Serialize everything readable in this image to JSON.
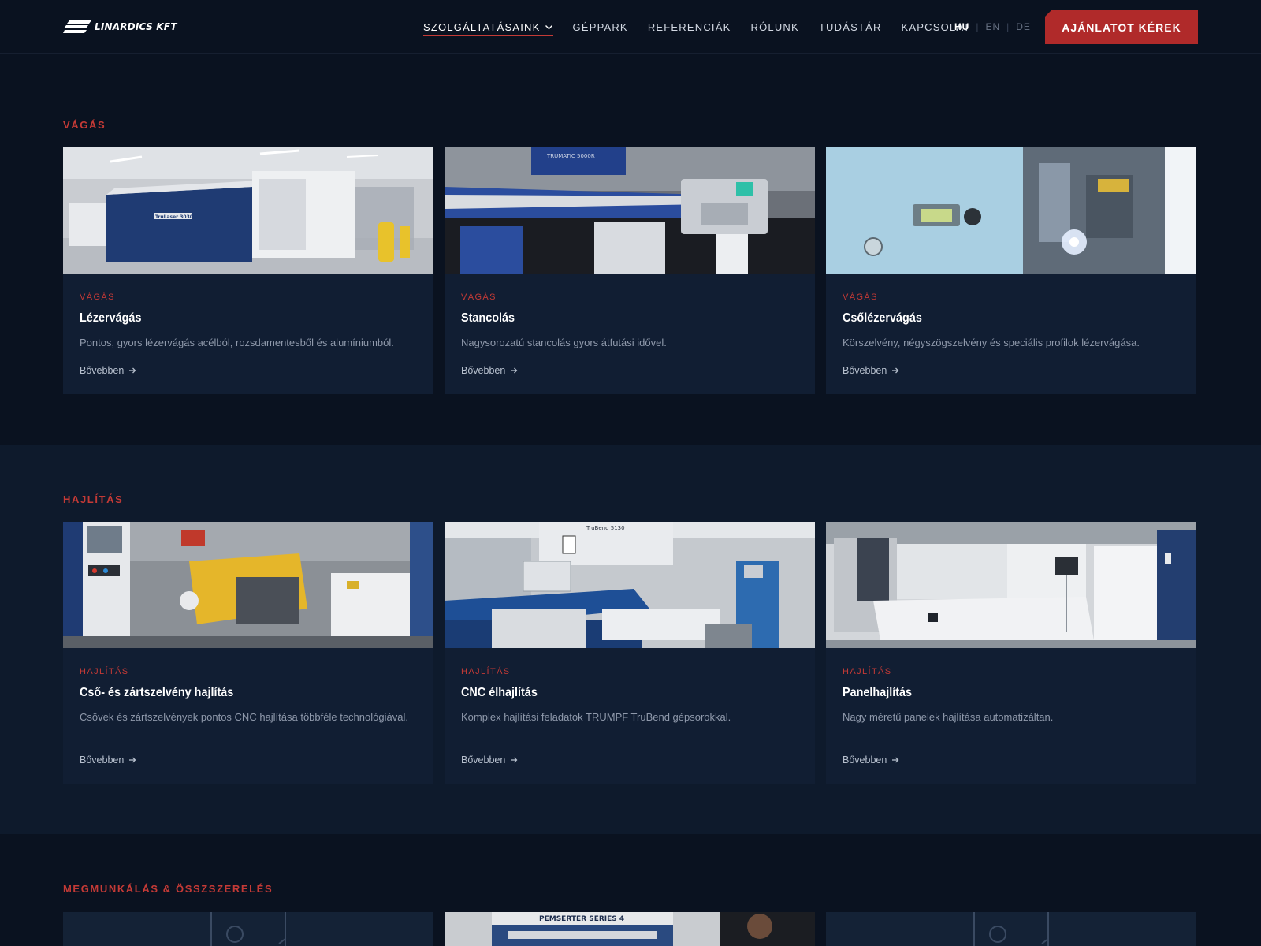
{
  "header": {
    "logo_text": "LINARDICS KFT",
    "nav": [
      {
        "label": "SZOLGÁLTATÁSAINK",
        "active": true
      },
      {
        "label": "GÉPPARK"
      },
      {
        "label": "REFERENCIÁK"
      },
      {
        "label": "RÓLUNK"
      },
      {
        "label": "TUDÁSTÁR"
      },
      {
        "label": "KAPCSOLAT"
      }
    ],
    "languages": [
      {
        "code": "HU",
        "current": true
      },
      {
        "code": "EN"
      },
      {
        "code": "DE"
      }
    ],
    "cta_label": "AJÁNLATOT KÉREK"
  },
  "colors": {
    "accent": "#c43a36",
    "cta": "#b02a2a",
    "background": "#0a1220",
    "section_alt": "#0e1a2c",
    "card": "#111e33"
  },
  "sections": [
    {
      "title": "VÁGÁS",
      "cards": [
        {
          "category": "VÁGÁS",
          "title": "Lézervágás",
          "description": "Pontos, gyors lézervágás acélból, rozsdamentesből és alumíniumból.",
          "link": "Bővebben"
        },
        {
          "category": "VÁGÁS",
          "title": "Stancolás",
          "description": "Nagysorozatú stancolás gyors átfutási idővel.",
          "link": "Bővebben"
        },
        {
          "category": "VÁGÁS",
          "title": "Csőlézervágás",
          "description": "Körszelvény, négyszögszelvény és speciális profilok lézervágása.",
          "link": "Bővebben"
        }
      ]
    },
    {
      "title": "HAJLÍTÁS",
      "cards": [
        {
          "category": "HAJLÍTÁS",
          "title": "Cső- és zártszelvény hajlítás",
          "description": "Csövek és zártszelvények pontos CNC hajlítása többféle technológiával.",
          "link": "Bővebben"
        },
        {
          "category": "HAJLÍTÁS",
          "title": "CNC élhajlítás",
          "description": "Komplex hajlítási feladatok TRUMPF TruBend gépsorokkal.",
          "link": "Bővebben"
        },
        {
          "category": "HAJLÍTÁS",
          "title": "Panelhajlítás",
          "description": "Nagy méretű panelek hajlítása automatizáltan.",
          "link": "Bővebben"
        }
      ]
    },
    {
      "title": "MEGMUNKÁLÁS & ÖSSZSZERELÉS"
    }
  ],
  "machine_labels": {
    "laser": "TruLaser 3030",
    "punch": "TRUMATIC 5000R",
    "press": "TruBend 5130",
    "pem": "PEMSERTER SERIES 4"
  },
  "icons": {
    "nav_dropdown": "chevron-down-icon",
    "card_link": "arrow-right-icon",
    "logo": "logo-stripes-icon"
  }
}
